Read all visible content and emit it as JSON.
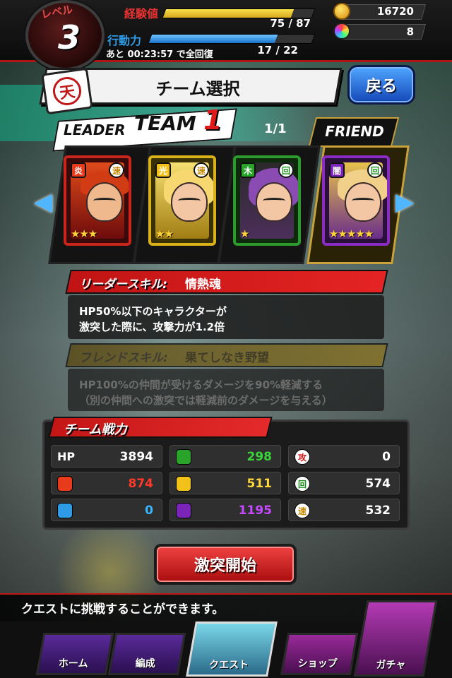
{
  "status": {
    "level_label": "レベル",
    "level": "3",
    "exp_label": "経験値",
    "exp_value": "75 / 87",
    "exp_progress": 0.862,
    "ap_label": "行動力",
    "ap_value": "17 / 22",
    "ap_progress": 0.773,
    "ap_recover": "あと 00:23:57 で全回復",
    "coins": "16720",
    "gems": "8"
  },
  "header": {
    "title": "チーム選択",
    "back_label": "戻る",
    "emblem_glyph": "天"
  },
  "team": {
    "leader_label": "LEADER",
    "team_label": "TEAM",
    "team_number": "1",
    "page_indicator": "1/1",
    "friend_label": "FRIEND"
  },
  "cards": [
    {
      "attribute": "fire",
      "attr_glyph": "炎",
      "role": "速",
      "stars": "★★★"
    },
    {
      "attribute": "light",
      "attr_glyph": "光",
      "role": "速",
      "stars": "★★"
    },
    {
      "attribute": "wood",
      "attr_glyph": "木",
      "role": "回",
      "stars": "★"
    },
    {
      "attribute": "dark",
      "attr_glyph": "闇",
      "role": "回",
      "stars": "★★★★★"
    }
  ],
  "leader_skill": {
    "tag": "リーダースキル:",
    "name": "情熱魂",
    "line1": "HP50%以下のキャラクターが",
    "line2": "激突した際に、攻撃力が1.2倍"
  },
  "friend_skill": {
    "tag": "フレンドスキル:",
    "name": "果てしなき野望",
    "line1": "HP100%の仲間が受けるダメージを90%軽減する",
    "line2": "（別の仲間への激突では軽減前のダメージを与える）"
  },
  "team_power": {
    "title": "チーム戦力",
    "hp_label": "HP",
    "hp": "3894",
    "wood": "298",
    "attack_glyph": "攻",
    "attack": "0",
    "fire": "874",
    "light": "511",
    "heal_glyph": "回",
    "heal": "574",
    "water": "0",
    "dark": "1195",
    "speed_glyph": "速",
    "speed": "532"
  },
  "start_button": "激突開始",
  "message": "クエストに挑戦することができます。",
  "nav": {
    "home": "ホーム",
    "formation": "編成",
    "quest": "クエスト",
    "shop": "ショップ",
    "gacha": "ガチャ"
  },
  "colors": {
    "accent_red": "#c41616",
    "fire": "#e73b1b",
    "light": "#f2c21a",
    "wood": "#2aa32a",
    "dark": "#7a24b8",
    "water": "#2f9be6",
    "back_blue": "#1446b8"
  }
}
